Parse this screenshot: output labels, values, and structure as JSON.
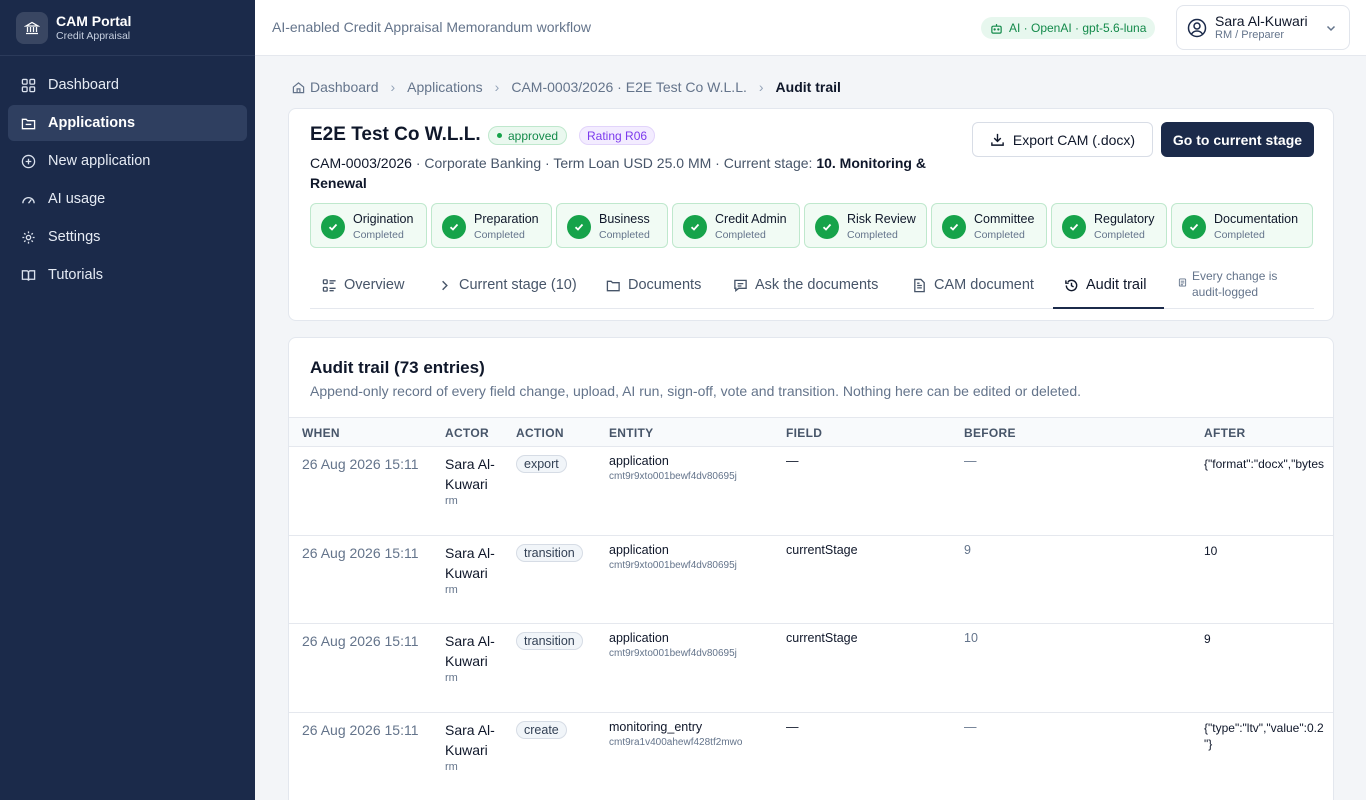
{
  "brand": {
    "title": "CAM Portal",
    "subtitle": "Credit Appraisal"
  },
  "nav": [
    {
      "label": "Dashboard",
      "icon": "grid-icon"
    },
    {
      "label": "Applications",
      "icon": "folder-icon"
    },
    {
      "label": "New application",
      "icon": "plus-circle-icon"
    },
    {
      "label": "AI usage",
      "icon": "gauge-icon"
    },
    {
      "label": "Settings",
      "icon": "gear-icon"
    },
    {
      "label": "Tutorials",
      "icon": "book-icon"
    }
  ],
  "topbar": {
    "tagline": "AI-enabled Credit Appraisal Memorandum workflow",
    "ai_badge": "AI · OpenAI · gpt-5.6-luna",
    "user_name": "Sara Al-Kuwari",
    "user_role": "RM / Preparer"
  },
  "breadcrumb": {
    "home": "Dashboard",
    "applications": "Applications",
    "application": "CAM-0003/2026 · E2E Test Co W.L.L.",
    "current": "Audit trail"
  },
  "application": {
    "name": "E2E Test Co W.L.L.",
    "status": "approved",
    "rating": "Rating R06",
    "code": "CAM-0003/2026",
    "meta": " · Corporate Banking · Term Loan USD 25.0 MM · Current stage: ",
    "current_stage": "10. Monitoring & Renewal",
    "export_label": "Export CAM (.docx)",
    "goto_label": "Go to current stage"
  },
  "stages": [
    {
      "name": "Origination",
      "status": "Completed"
    },
    {
      "name": "Preparation",
      "status": "Completed"
    },
    {
      "name": "Business",
      "status": "Completed"
    },
    {
      "name": "Credit Admin",
      "status": "Completed"
    },
    {
      "name": "Risk Review",
      "status": "Completed"
    },
    {
      "name": "Committee",
      "status": "Completed"
    },
    {
      "name": "Regulatory",
      "status": "Completed"
    },
    {
      "name": "Documentation",
      "status": "Completed"
    }
  ],
  "tabs": [
    {
      "label": "Overview"
    },
    {
      "label": "Current stage (10)"
    },
    {
      "label": "Documents"
    },
    {
      "label": "Ask the documents"
    },
    {
      "label": "CAM document"
    },
    {
      "label": "Audit trail"
    }
  ],
  "tab_note": "Every change is\naudit-logged",
  "audit": {
    "title": "Audit trail (73 entries)",
    "description": "Append-only record of every field change, upload, AI run, sign-off, vote and transition. Nothing here can be edited or deleted.",
    "columns": [
      "WHEN",
      "ACTOR",
      "ACTION",
      "ENTITY",
      "FIELD",
      "BEFORE",
      "AFTER"
    ],
    "rows": [
      {
        "when": "26 Aug 2026 15:11",
        "actor": "Sara Al-Kuwari",
        "role": "rm",
        "action": "export",
        "entity": "application",
        "entity_id": "cmt9r9xto001bewf4dv80695j",
        "field": "—",
        "before": "—",
        "after": "{\"format\":\"docx\",\"bytes"
      },
      {
        "when": "26 Aug 2026 15:11",
        "actor": "Sara Al-Kuwari",
        "role": "rm",
        "action": "transition",
        "entity": "application",
        "entity_id": "cmt9r9xto001bewf4dv80695j",
        "field": "currentStage",
        "before": "9",
        "after": "10"
      },
      {
        "when": "26 Aug 2026 15:11",
        "actor": "Sara Al-Kuwari",
        "role": "rm",
        "action": "transition",
        "entity": "application",
        "entity_id": "cmt9r9xto001bewf4dv80695j",
        "field": "currentStage",
        "before": "10",
        "after": "9"
      },
      {
        "when": "26 Aug 2026 15:11",
        "actor": "Sara Al-Kuwari",
        "role": "rm",
        "action": "create",
        "entity": "monitoring_entry",
        "entity_id": "cmt9ra1v400ahewf428tf2mwo",
        "field": "—",
        "before": "—",
        "after": "{\"type\":\"ltv\",\"value\":0.2\n\"}"
      }
    ]
  },
  "colors": {
    "sidebar": "#1b2a4a",
    "accent": "#1b2a4a",
    "success": "#16a34a",
    "rating": "#7c3aed"
  }
}
